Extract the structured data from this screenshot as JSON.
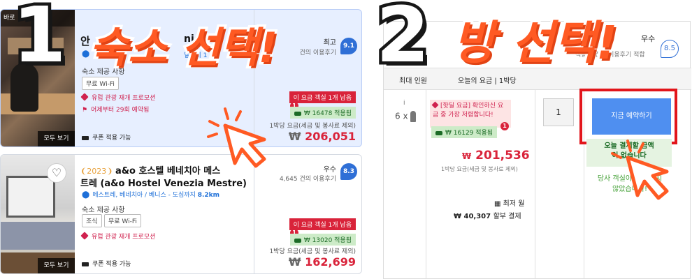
{
  "step1": {
    "number": "1",
    "title": "숙소 선택!"
  },
  "step2": {
    "number": "2",
    "title": "방 선택!"
  },
  "listing1": {
    "name_fragment": "안",
    "name_suffix": "nice",
    "location_fragment": "엘까지 1",
    "amenities_label": "숙소 제공 사항",
    "amenities": [
      "무료 Wi-Fi"
    ],
    "promo_text": "유럽 관광 재개 프로모션",
    "booked_text": "어제부터 29회 예약됨",
    "coupon_text": "쿠폰 적용 가능",
    "thumb_top": "바로",
    "thumb_all": "모두 보기",
    "rating_word": "최고",
    "review_count": "건의 이용후기",
    "score": "9.1",
    "alert": "이 요금 객실 1개 남음",
    "badge": "1",
    "discount": "₩ 16478 적용됨",
    "per_night": "1박당 요금(세금 및 봉사료 제외)",
    "currency": "₩",
    "price": "206,051"
  },
  "listing2": {
    "year_tag": "2023",
    "name_ko": "a&o 호스텔 베네치아 메스",
    "name_ko2": "트레 (a&o Hostel Venezia Mestre)",
    "location": "메스트레, 베네치아 / 베니스 - 도심까지",
    "distance": "8.2km",
    "amenities_label": "숙소 제공 사항",
    "amenities": [
      "조식",
      "무료 Wi-Fi"
    ],
    "promo_text": "유럽 관광 재개 프로모션",
    "coupon_text": "쿠폰 적용 가능",
    "thumb_all": "모두 보기",
    "rating_word": "우수",
    "review_count": "4,645 건의 이용후기",
    "score": "8.3",
    "alert": "이 요금 객실 1개 남음",
    "badge": "1",
    "discount": "₩ 13020 적용됨",
    "per_night": "1박당 요금(세금 및 봉사료 제외)",
    "currency": "₩",
    "price": "162,699"
  },
  "room": {
    "rating_word": "우수",
    "score": "8.5",
    "review_fragment": "적용된 건의 이용후기 적합",
    "header_capacity": "최대 인원",
    "header_price": "오늘의 요금 | 1박당",
    "info_icon": "i",
    "occupancy": "6 x",
    "hotdeal_line1": "[핫딜 요금] 확인하신 요",
    "hotdeal_line2": "금 중 가장 저렴합니다!",
    "discount": "₩ 16129 적용됨",
    "badge": "1",
    "currency": "₩",
    "price": "201,536",
    "per_night": "1박당 요금(세금 및 봉사료 제외)",
    "lowest_label": "최저 월",
    "installment": "₩ 40,307",
    "installment_suffix": "할부 결제",
    "quantity": "1",
    "book_label": "지금 예약하기",
    "green_line1": "오늘 결제할 금액",
    "green_line2": "이 없습니다",
    "hint_line1": "당사 객실이 얼마 남지",
    "hint_line2": "않았습니다!"
  },
  "colors": {
    "accent": "#ff5a23",
    "price": "#d9233a",
    "brand": "#2f6fd6",
    "book": "#4f8ff0"
  }
}
